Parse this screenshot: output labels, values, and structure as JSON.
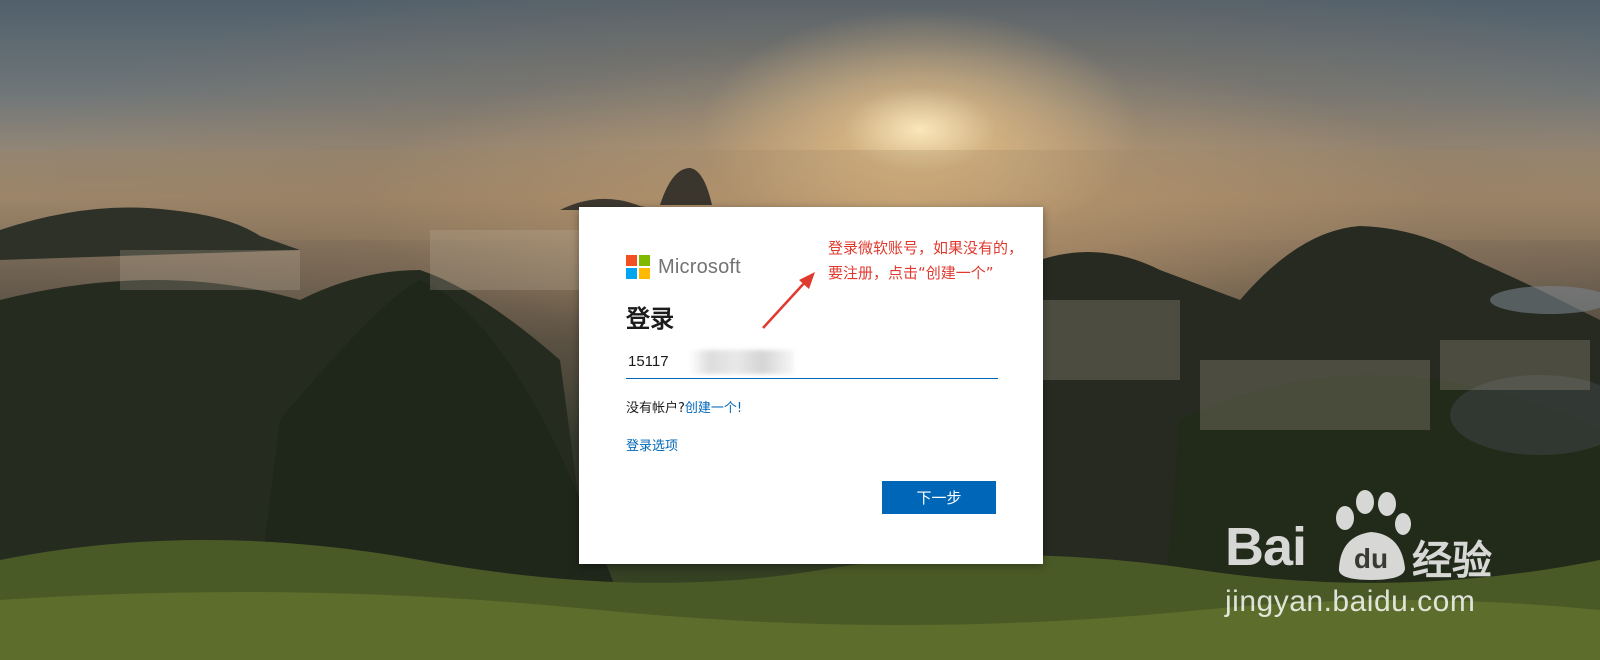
{
  "brand": {
    "name": "Microsoft",
    "logo_colors": [
      "#f25022",
      "#7fba00",
      "#00a4ef",
      "#ffb900"
    ]
  },
  "signin": {
    "title": "登录",
    "account_value": "15117",
    "no_account_text": "没有帐户?",
    "create_link": "创建一个!",
    "options_link": "登录选项",
    "next_button": "下一步"
  },
  "annotation": {
    "text": "登录微软账号，如果没有的，要注册，点击“创建一个”",
    "color": "#e03a2f"
  },
  "watermark": {
    "brand": "Bai",
    "brand_paw_text": "du",
    "cn": "经验",
    "url": "jingyan.baidu.com"
  },
  "colors": {
    "accent": "#0067b8",
    "card_bg": "#ffffff"
  }
}
